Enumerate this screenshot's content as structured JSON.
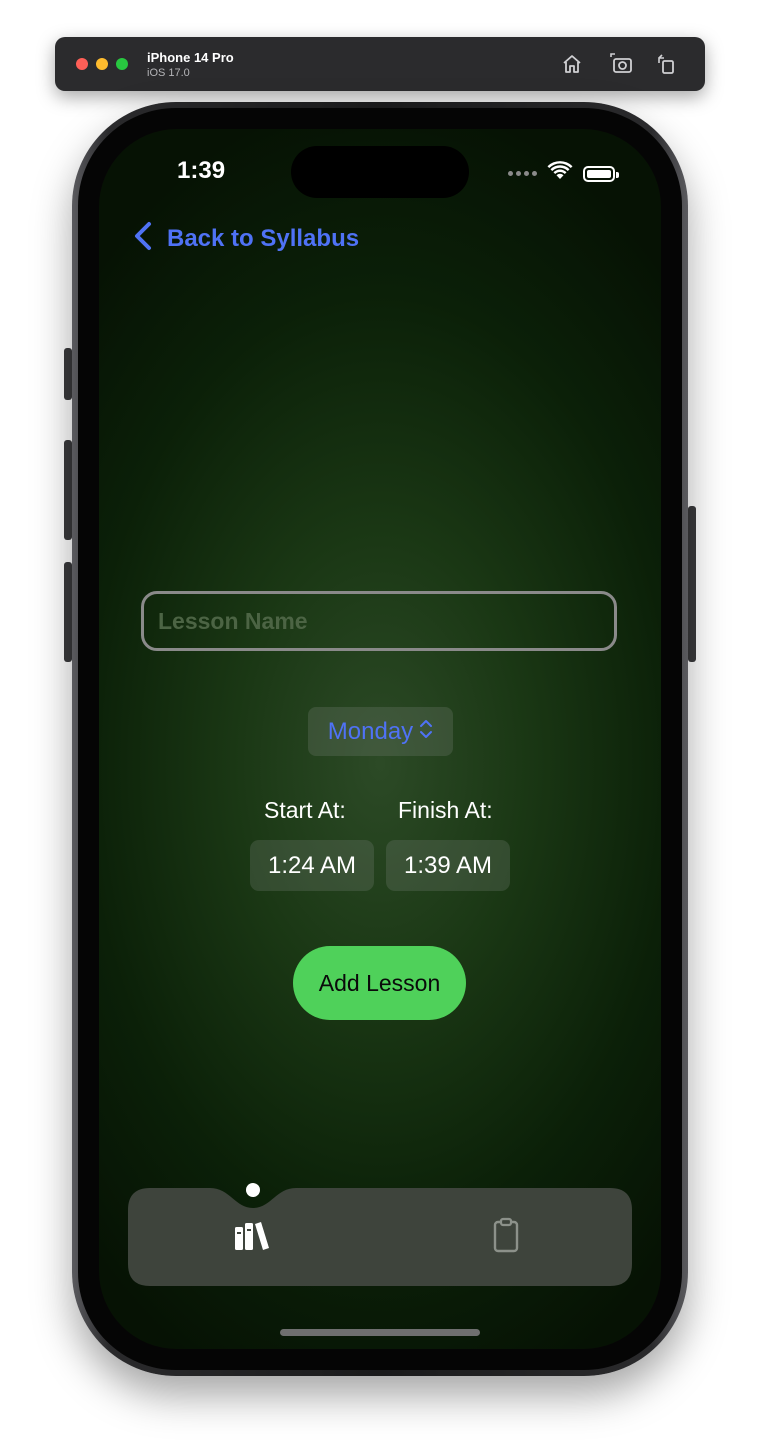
{
  "simulator": {
    "device_name": "iPhone 14 Pro",
    "os_version": "iOS 17.0",
    "buttons": [
      "home-icon",
      "screenshot-icon",
      "rotate-icon"
    ]
  },
  "status_bar": {
    "time": "1:39",
    "icons": [
      "signal-dots-icon",
      "wifi-icon",
      "battery-icon"
    ]
  },
  "navigation": {
    "back_label": "Back to Syllabus",
    "back_icon": "chevron-left-icon"
  },
  "form": {
    "lesson_name_placeholder": "Lesson Name",
    "lesson_name_value": "",
    "day_selected": "Monday",
    "start_label": "Start At:",
    "finish_label": "Finish At:",
    "start_time": "1:24 AM",
    "finish_time": "1:39 AM",
    "add_button_label": "Add Lesson"
  },
  "tab_bar": {
    "items": [
      {
        "icon": "books-icon",
        "selected": true
      },
      {
        "icon": "clipboard-icon",
        "selected": false
      }
    ]
  },
  "colors": {
    "accent_blue": "#4f72f5",
    "add_button_green": "#4fd15a",
    "background_green": "#1a3714"
  }
}
